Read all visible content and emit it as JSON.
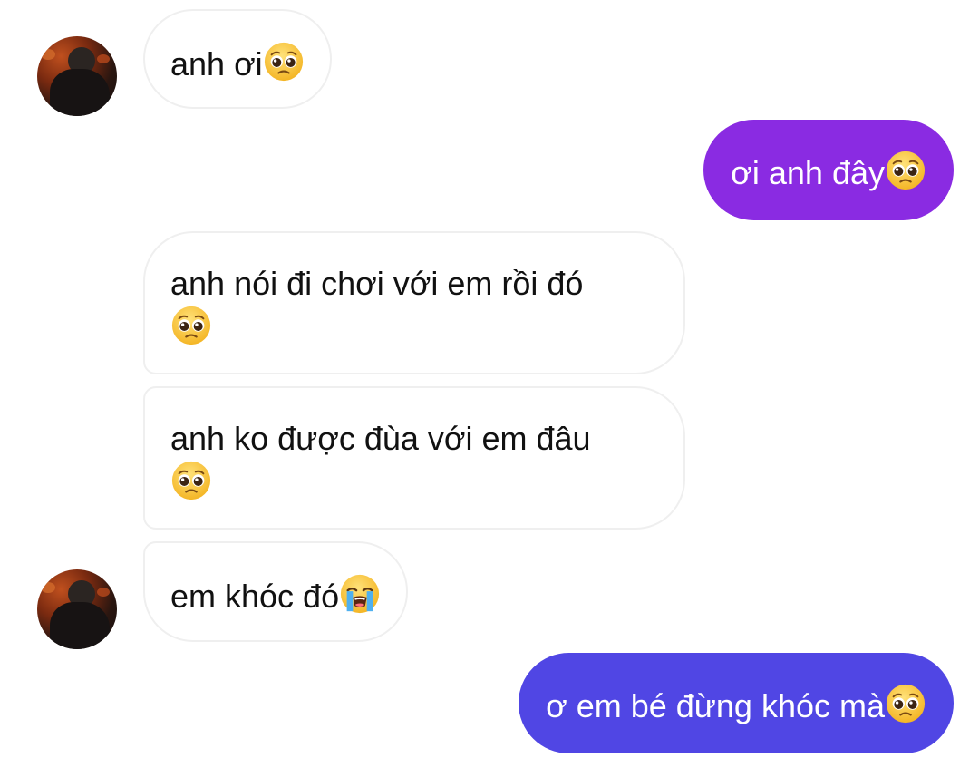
{
  "messages": [
    {
      "text": "anh ơi",
      "emoji": "🥺",
      "sender": "them"
    },
    {
      "text": "ơi anh đây",
      "emoji": "🥺",
      "sender": "me"
    },
    {
      "text": "anh nói đi chơi với em rồi đó",
      "emoji": "🥺",
      "sender": "them"
    },
    {
      "text": "anh ko được đùa với em đâu",
      "emoji": "🥺",
      "sender": "them"
    },
    {
      "text": "em khóc đó",
      "emoji": "😭",
      "sender": "them"
    },
    {
      "text": "ơ em bé đừng khóc mà",
      "emoji": "🥺",
      "sender": "me"
    }
  ],
  "icons": {
    "pleading_face": "pleading-face-emoji",
    "crying_face": "loudly-crying-face-emoji"
  },
  "colors": {
    "outgoing_bubble_top": "#8a2be2",
    "outgoing_bubble_bottom": "#5046e4",
    "incoming_bubble_bg": "#ffffff",
    "incoming_bubble_border": "#efefef",
    "incoming_text": "#111111",
    "outgoing_text": "#ffffff"
  }
}
